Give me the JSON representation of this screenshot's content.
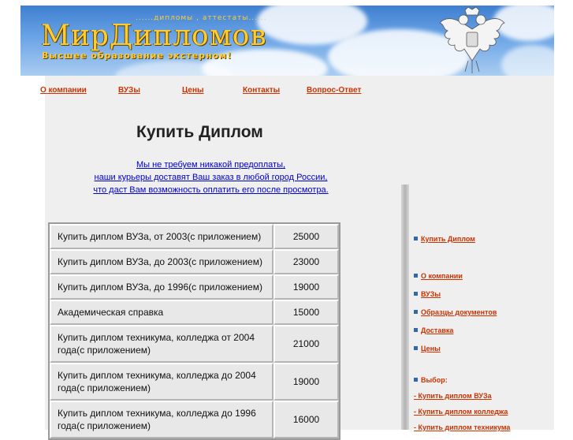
{
  "header": {
    "logo_title": "МирДипломов",
    "logo_top": "......дипломы , аттестаты......",
    "logo_subtitle": "Высшее образование экстерном!"
  },
  "nav": [
    {
      "label": "О компании"
    },
    {
      "label": "ВУЗы"
    },
    {
      "label": "Цены"
    },
    {
      "label": "Контакты"
    },
    {
      "label": "Вопрос-Ответ"
    }
  ],
  "main": {
    "title": "Купить Диплом",
    "intro_lines": [
      "Мы не требуем никакой предоплаты,",
      "наши курьеры доставят Ваш заказ в любой город России,",
      "что даст Вам возможность оплатить его после просмотра."
    ],
    "prices": [
      {
        "name": "Купить диплом ВУЗа, от 2003(с приложением)",
        "price": "25000"
      },
      {
        "name": "Купить диплом ВУЗа, до 2003(с приложением)",
        "price": "23000"
      },
      {
        "name": "Купить диплом ВУЗа, до 1996(с приложением)",
        "price": "19000"
      },
      {
        "name": "Академическая справка",
        "price": "15000"
      },
      {
        "name": "Купить диплом техникума, колледжа от 2004 года(с приложением)",
        "price": "21000"
      },
      {
        "name": "Купить диплом техникума, колледжа до 2004 года(с приложением)",
        "price": "19000"
      },
      {
        "name": "Купить диплом техникума, колледжа до 1996 года(с приложением)",
        "price": "16000"
      }
    ]
  },
  "sidebar": {
    "items": [
      {
        "label": "Купить Диплом"
      },
      {
        "label": "О компании"
      },
      {
        "label": "ВУЗы"
      },
      {
        "label": "Образцы документов"
      },
      {
        "label": "Доставка"
      },
      {
        "label": "Цены"
      }
    ],
    "choice_label": "Выбор:",
    "choices": [
      {
        "label": "- Купить диплом ВУЗа"
      },
      {
        "label": "- Купить диплом колледжа"
      },
      {
        "label": "- Купить диплом техникума"
      }
    ]
  },
  "colors": {
    "link": "#cc3300",
    "intro_link": "#0000cc",
    "logo": "#ffcc33",
    "sky": "#3f7fd0"
  }
}
